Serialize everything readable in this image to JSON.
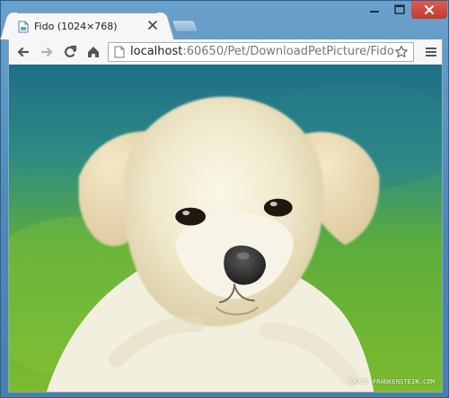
{
  "browser": {
    "tab": {
      "title": "Fido (1024×768)"
    },
    "address_bar": {
      "host": "localhost",
      "path": ":60650/Pet/DownloadPetPicture/Fido"
    }
  },
  "image": {
    "subject": "white puppy photo",
    "watermark": "CRAZY FRANKENSTEIN.COM"
  },
  "icons": {
    "favicon": "image-file-icon",
    "tab_close": "close-icon",
    "new_tab": "new-tab-icon",
    "minimize": "minimize-icon",
    "maximize": "maximize-icon",
    "close_window": "close-icon",
    "back": "arrow-left-icon",
    "forward": "arrow-right-icon",
    "reload": "reload-icon",
    "home": "home-icon",
    "page": "page-icon",
    "star": "star-icon",
    "menu": "menu-icon"
  },
  "colors": {
    "window_frame": "#5d8fb8",
    "close_button": "#c53a2d",
    "tab_background": "#f6f6f6"
  }
}
